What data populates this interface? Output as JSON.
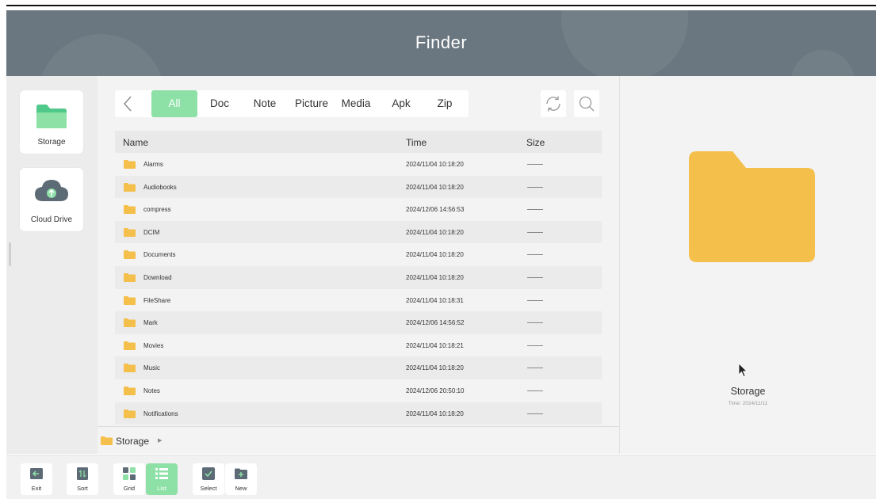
{
  "app": {
    "title": "Finder"
  },
  "sidebar": {
    "items": [
      {
        "label": "Storage",
        "icon": "folder-icon"
      },
      {
        "label": "Cloud Drive",
        "icon": "cloud-upload-icon"
      }
    ]
  },
  "filters": {
    "back_icon": "chevron-left-icon",
    "tabs": [
      "All",
      "Doc",
      "Note",
      "Picture",
      "Media",
      "Apk",
      "Zip"
    ],
    "active": "All",
    "refresh_icon": "refresh-icon",
    "search_icon": "search-icon"
  },
  "table": {
    "columns": [
      "Name",
      "Time",
      "Size"
    ],
    "rows": [
      {
        "name": "Alarms",
        "time": "2024/11/04 10:18:20"
      },
      {
        "name": "Audiobooks",
        "time": "2024/11/04 10:18:20"
      },
      {
        "name": "compress",
        "time": "2024/12/06 14:56:53"
      },
      {
        "name": "DCIM",
        "time": "2024/11/04 10:18:20"
      },
      {
        "name": "Documents",
        "time": "2024/11/04 10:18:20"
      },
      {
        "name": "Download",
        "time": "2024/11/04 10:18:20"
      },
      {
        "name": "FileShare",
        "time": "2024/11/04 10:18:31"
      },
      {
        "name": "Mark",
        "time": "2024/12/06 14:56:52"
      },
      {
        "name": "Movies",
        "time": "2024/11/04 10:18:21"
      },
      {
        "name": "Music",
        "time": "2024/11/04 10:18:20"
      },
      {
        "name": "Notes",
        "time": "2024/12/06 20:50:10"
      },
      {
        "name": "Notifications",
        "time": "2024/11/04 10:18:20"
      }
    ]
  },
  "breadcrumb": {
    "label": "Storage"
  },
  "preview": {
    "name": "Storage",
    "time": "Time: 2024/11/11"
  },
  "toolbar": {
    "buttons": [
      {
        "label": "Exit",
        "icon": "exit-icon"
      },
      {
        "label": "Sort",
        "icon": "sort-icon"
      },
      {
        "label": "Grid",
        "icon": "grid-icon"
      },
      {
        "label": "List",
        "icon": "list-icon",
        "active": true
      },
      {
        "label": "Select",
        "icon": "checkbox-icon"
      },
      {
        "label": "New",
        "icon": "new-folder-icon"
      }
    ]
  },
  "colors": {
    "accent": "#8de0a6",
    "folder": "#f5bf4c",
    "header": "#6b7780"
  }
}
